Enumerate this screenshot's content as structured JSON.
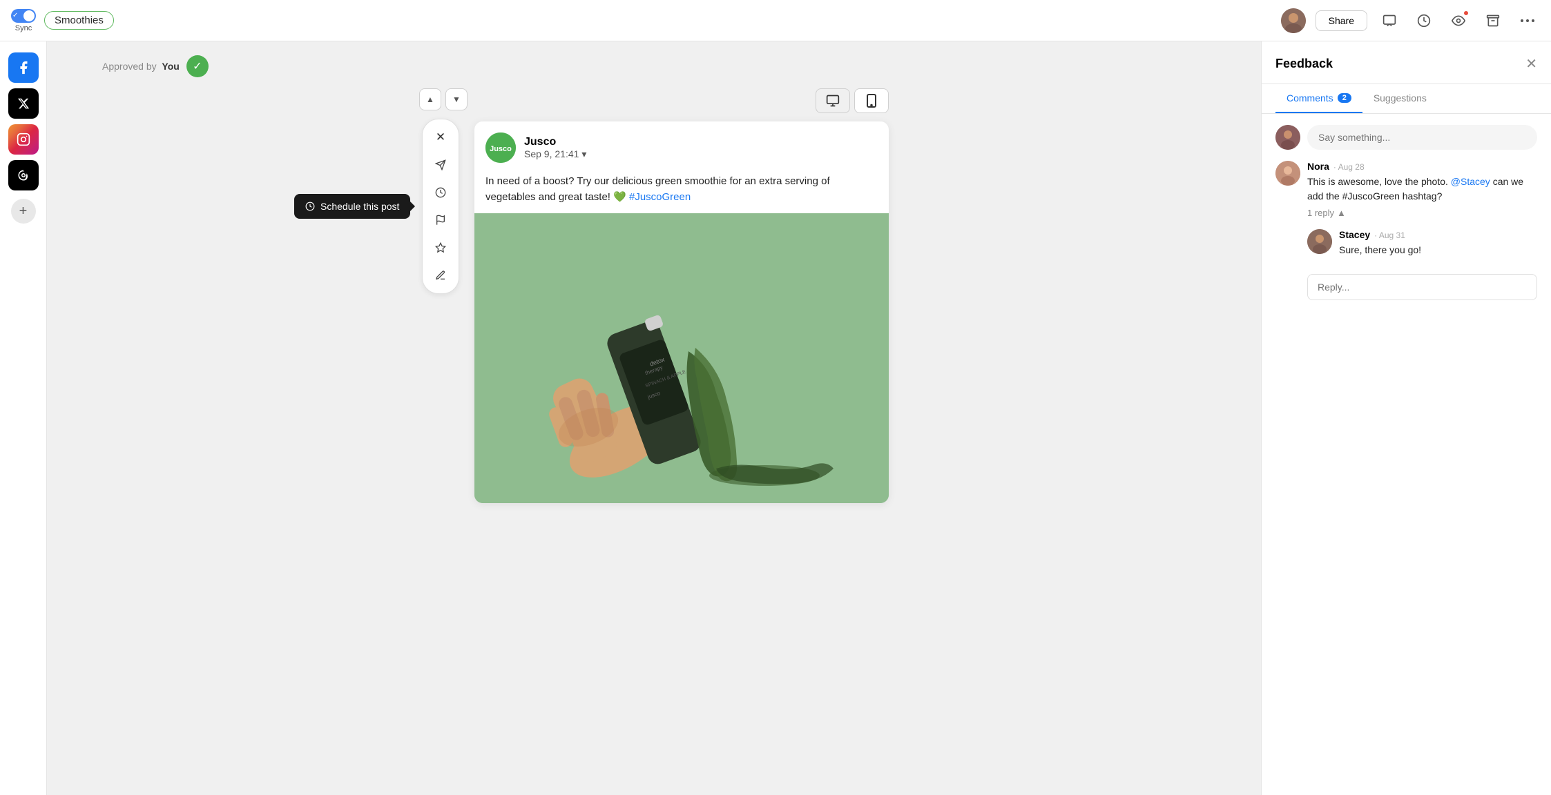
{
  "topbar": {
    "brand": "Smoothies",
    "share_label": "Share",
    "sync_label": "Sync"
  },
  "sidebar": {
    "icons": [
      {
        "name": "facebook",
        "label": "Facebook",
        "symbol": "f"
      },
      {
        "name": "x-twitter",
        "label": "X (Twitter)",
        "symbol": "𝕏"
      },
      {
        "name": "instagram",
        "label": "Instagram",
        "symbol": "◉"
      },
      {
        "name": "threads",
        "label": "Threads",
        "symbol": "@"
      },
      {
        "name": "add",
        "label": "Add",
        "symbol": "+"
      }
    ]
  },
  "post": {
    "approved_text": "Approved by",
    "approved_by": "You",
    "author": "Jusco",
    "date": "Sep 9, 21:41",
    "body": "In need of a boost? Try our delicious green smoothie for an extra serving of vegetables and great taste! 💚",
    "hashtag": "#JuscoGreen",
    "schedule_tooltip": "Schedule this post"
  },
  "toolbar": {
    "buttons": [
      {
        "name": "close",
        "symbol": "✕"
      },
      {
        "name": "send",
        "symbol": "➤"
      },
      {
        "name": "schedule",
        "symbol": "⏱"
      },
      {
        "name": "flag",
        "symbol": "⚑"
      },
      {
        "name": "label",
        "symbol": "◇"
      },
      {
        "name": "pen",
        "symbol": "✎"
      }
    ]
  },
  "feedback": {
    "title": "Feedback",
    "tabs": [
      {
        "label": "Comments",
        "badge": "2",
        "active": true
      },
      {
        "label": "Suggestions",
        "badge": null,
        "active": false
      }
    ],
    "input_placeholder": "Say something...",
    "reply_placeholder": "Reply...",
    "comments": [
      {
        "author": "Nora",
        "date": "Aug 28",
        "text_before": "This is awesome, love the photo.",
        "mention": "@Stacey",
        "text_after": "can we add the #JuscoGreen hashtag?",
        "replies_count": "1 reply"
      },
      {
        "author": "Stacey",
        "date": "Aug 31",
        "text": "Sure, there you go!"
      }
    ]
  }
}
